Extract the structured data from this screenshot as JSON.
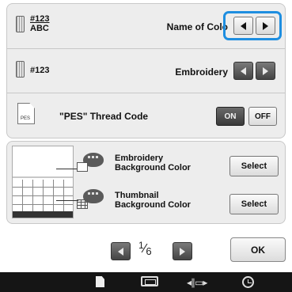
{
  "thread_display": {
    "code_number": "#123",
    "code_abc": "ABC",
    "label": "Name of Colo",
    "prev_icon": "left-arrow",
    "next_icon": "right-arrow"
  },
  "thread_number": {
    "code_number": "#123",
    "label": "Embroidery"
  },
  "pes_thread_code": {
    "label": "\"PES\" Thread Code",
    "file_icon_text": "PES",
    "on_label": "ON",
    "off_label": "OFF",
    "selected": "ON"
  },
  "embroidery_background": {
    "label_line1": "Embroidery",
    "label_line2": "Background Color",
    "button": "Select"
  },
  "thumbnail_background": {
    "label_line1": "Thumbnail",
    "label_line2": "Background Color",
    "button": "Select"
  },
  "pager": {
    "current": "1",
    "total": "6"
  },
  "ok_label": "OK",
  "colors": {
    "highlight": "#1e8ee0",
    "panel": "#ededed",
    "bottom_bar": "#151515"
  },
  "bottom_bar_icons": [
    "document-icon",
    "hoop-icon",
    "presser-foot-icon",
    "clock-icon"
  ]
}
